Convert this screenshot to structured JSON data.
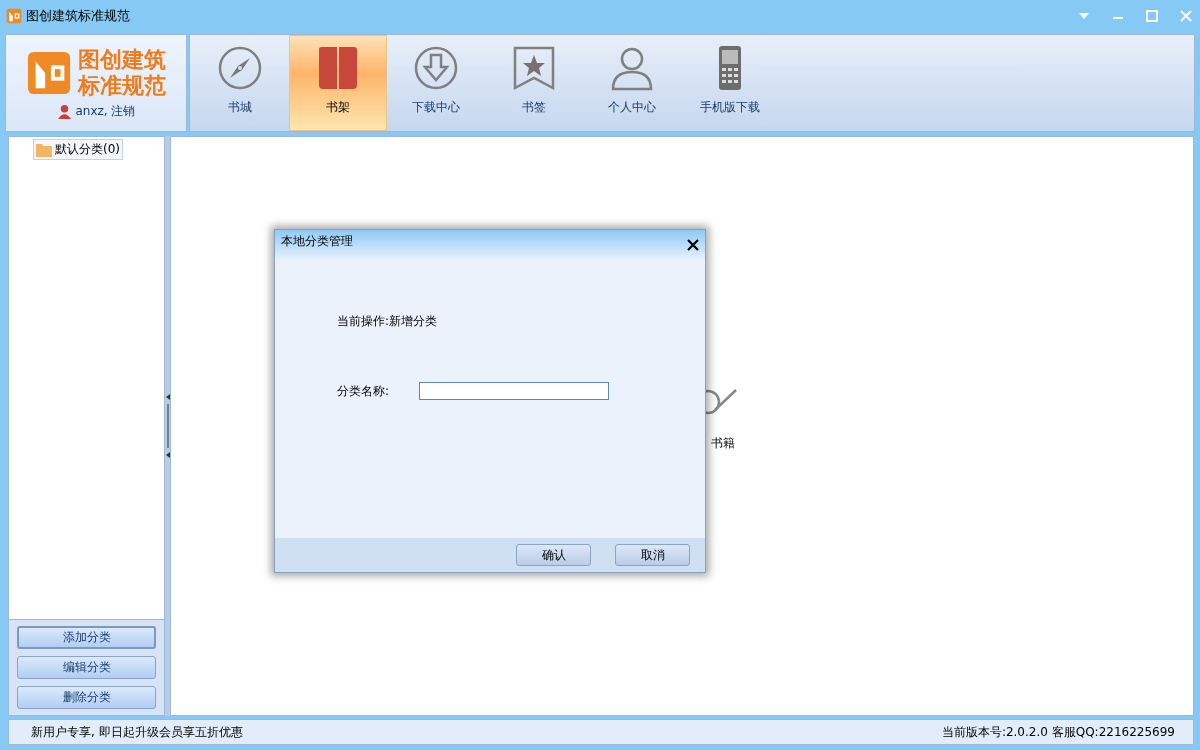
{
  "window": {
    "title": "图创建筑标准规范"
  },
  "brand": {
    "name_line1": "图创建筑",
    "name_line2": "标准规范",
    "user": "anxz, 注销"
  },
  "tabs": [
    {
      "label": "书城",
      "kind": "compass",
      "selected": false
    },
    {
      "label": "书架",
      "kind": "book",
      "selected": true
    },
    {
      "label": "下载中心",
      "kind": "download",
      "selected": false
    },
    {
      "label": "书签",
      "kind": "bookmark",
      "selected": false
    },
    {
      "label": "个人中心",
      "kind": "person",
      "selected": false
    },
    {
      "label": "手机版下载",
      "kind": "phone",
      "selected": false
    }
  ],
  "sidebar": {
    "items": [
      {
        "label": "默认分类(0)",
        "selected": true
      }
    ],
    "buttons": [
      {
        "label": "添加分类",
        "selected": true
      },
      {
        "label": "编辑分类",
        "selected": false
      },
      {
        "label": "删除分类",
        "selected": false
      }
    ]
  },
  "content": {
    "empty_text": "书籍"
  },
  "dialog": {
    "title": "本地分类管理",
    "operation": "当前操作:新增分类",
    "field_label": "分类名称:",
    "buttons": [
      "确认",
      "取消"
    ]
  },
  "status_bar": {
    "left": "新用户专享, 即日起升级会员享五折优惠",
    "right": "当前版本号:2.0.2.0 客服QQ:2216225699"
  }
}
